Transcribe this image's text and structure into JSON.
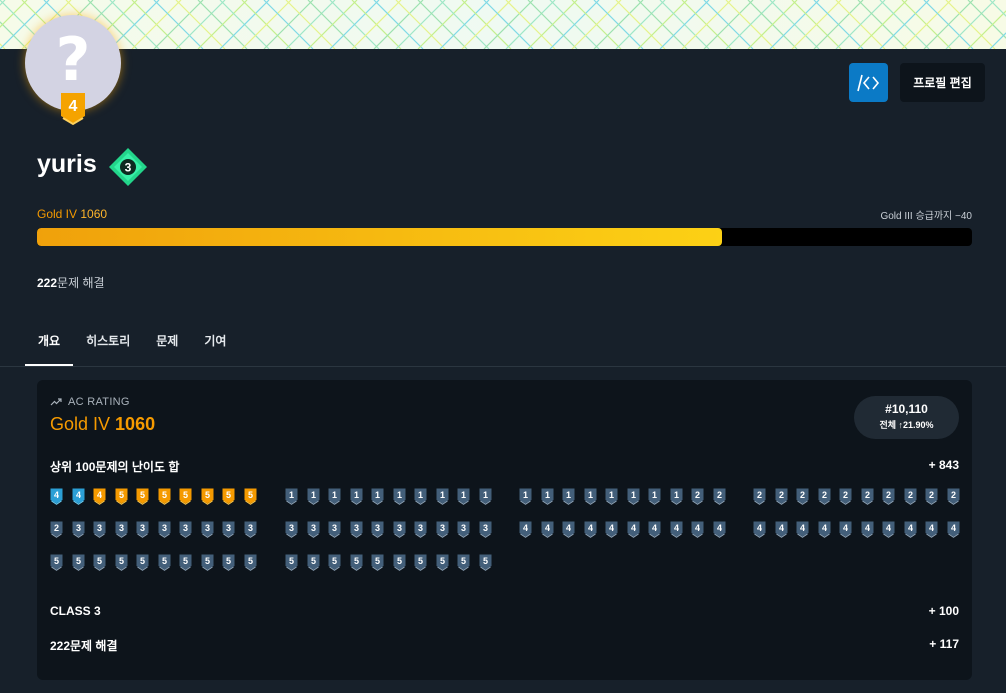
{
  "header": {
    "code_button_label": "/<>",
    "edit_button_label": "프로필 편집",
    "avatar_placeholder": "?",
    "avatar_tier_badge": "4"
  },
  "profile": {
    "username": "yuris",
    "class_badge": "3",
    "tier_name": "Gold IV",
    "rating": "1060",
    "next_tier_text": "Gold III 승급까지 −40",
    "progress_fraction": 0.733,
    "solved_count": "222",
    "solved_suffix": "문제 해결"
  },
  "tabs": [
    {
      "label": "개요",
      "active": true
    },
    {
      "label": "히스토리",
      "active": false
    },
    {
      "label": "문제",
      "active": false
    },
    {
      "label": "기여",
      "active": false
    }
  ],
  "ac_rating": {
    "label": "AC RATING",
    "tier": "Gold IV",
    "rating": "1060",
    "rank": "#10,110",
    "rank_sub": "전체 ↑21.90%",
    "top100_label": "상위 100문제의 난이도 합",
    "top100_value": "+ 843",
    "class_label": "CLASS 3",
    "class_value": "+ 100",
    "solved_label": "222문제 해결",
    "solved_value": "+ 117"
  },
  "top_problems": {
    "groups": [
      [
        [
          "p",
          4
        ],
        [
          "p",
          4
        ],
        [
          "g",
          4
        ],
        [
          "g",
          5
        ],
        [
          "g",
          5
        ],
        [
          "g",
          5
        ],
        [
          "g",
          5
        ],
        [
          "g",
          5
        ],
        [
          "g",
          5
        ],
        [
          "g",
          5
        ]
      ],
      [
        [
          "s",
          1
        ],
        [
          "s",
          1
        ],
        [
          "s",
          1
        ],
        [
          "s",
          1
        ],
        [
          "s",
          1
        ],
        [
          "s",
          1
        ],
        [
          "s",
          1
        ],
        [
          "s",
          1
        ],
        [
          "s",
          1
        ],
        [
          "s",
          1
        ]
      ],
      [
        [
          "s",
          1
        ],
        [
          "s",
          1
        ],
        [
          "s",
          1
        ],
        [
          "s",
          1
        ],
        [
          "s",
          1
        ],
        [
          "s",
          1
        ],
        [
          "s",
          1
        ],
        [
          "s",
          1
        ],
        [
          "s",
          2
        ],
        [
          "s",
          2
        ]
      ],
      [
        [
          "s",
          2
        ],
        [
          "s",
          2
        ],
        [
          "s",
          2
        ],
        [
          "s",
          2
        ],
        [
          "s",
          2
        ],
        [
          "s",
          2
        ],
        [
          "s",
          2
        ],
        [
          "s",
          2
        ],
        [
          "s",
          2
        ],
        [
          "s",
          2
        ]
      ],
      [
        [
          "s",
          2
        ],
        [
          "s",
          3
        ],
        [
          "s",
          3
        ],
        [
          "s",
          3
        ],
        [
          "s",
          3
        ],
        [
          "s",
          3
        ],
        [
          "s",
          3
        ],
        [
          "s",
          3
        ],
        [
          "s",
          3
        ],
        [
          "s",
          3
        ]
      ],
      [
        [
          "s",
          3
        ],
        [
          "s",
          3
        ],
        [
          "s",
          3
        ],
        [
          "s",
          3
        ],
        [
          "s",
          3
        ],
        [
          "s",
          3
        ],
        [
          "s",
          3
        ],
        [
          "s",
          3
        ],
        [
          "s",
          3
        ],
        [
          "s",
          3
        ]
      ],
      [
        [
          "s",
          4
        ],
        [
          "s",
          4
        ],
        [
          "s",
          4
        ],
        [
          "s",
          4
        ],
        [
          "s",
          4
        ],
        [
          "s",
          4
        ],
        [
          "s",
          4
        ],
        [
          "s",
          4
        ],
        [
          "s",
          4
        ],
        [
          "s",
          4
        ]
      ],
      [
        [
          "s",
          4
        ],
        [
          "s",
          4
        ],
        [
          "s",
          4
        ],
        [
          "s",
          4
        ],
        [
          "s",
          4
        ],
        [
          "s",
          4
        ],
        [
          "s",
          4
        ],
        [
          "s",
          4
        ],
        [
          "s",
          4
        ],
        [
          "s",
          4
        ]
      ],
      [
        [
          "s",
          5
        ],
        [
          "s",
          5
        ],
        [
          "s",
          5
        ],
        [
          "s",
          5
        ],
        [
          "s",
          5
        ],
        [
          "s",
          5
        ],
        [
          "s",
          5
        ],
        [
          "s",
          5
        ],
        [
          "s",
          5
        ],
        [
          "s",
          5
        ]
      ],
      [
        [
          "s",
          5
        ],
        [
          "s",
          5
        ],
        [
          "s",
          5
        ],
        [
          "s",
          5
        ],
        [
          "s",
          5
        ],
        [
          "s",
          5
        ],
        [
          "s",
          5
        ],
        [
          "s",
          5
        ],
        [
          "s",
          5
        ],
        [
          "s",
          5
        ]
      ]
    ]
  },
  "colors": {
    "gold": "#f59a00",
    "platinum": "#27e2a4",
    "silver": "#435f7a",
    "accent_blue": "#0b7ac6"
  },
  "icons": {
    "trend": "trending-up-icon",
    "code": "code-icon"
  }
}
